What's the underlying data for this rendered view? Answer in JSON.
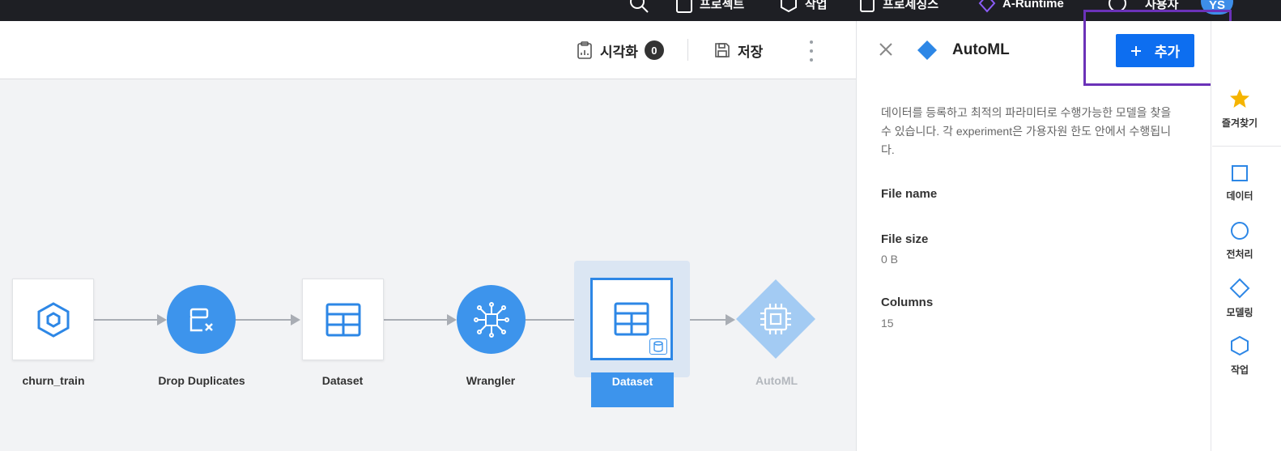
{
  "topbar": {
    "items": [
      {
        "label": "",
        "icon": "search-icon"
      },
      {
        "label": "프로젝트",
        "icon": "clipboard-icon"
      },
      {
        "label": "작업",
        "icon": "hexagon-icon"
      },
      {
        "label": "프로세싱스",
        "icon": "document-icon"
      },
      {
        "label": "A-Runtime",
        "icon": "diamond-icon"
      },
      {
        "label": "사용자",
        "icon": "info-icon"
      }
    ],
    "avatar": "YS"
  },
  "toolbar": {
    "visualize_label": "시각화",
    "visualize_count": "0",
    "save_label": "저장"
  },
  "pipeline": {
    "nodes": [
      {
        "label": "churn_train",
        "shape": "square",
        "icon": "hexagon-icon"
      },
      {
        "label": "Drop Duplicates",
        "shape": "circle",
        "icon": "drop-duplicates-icon"
      },
      {
        "label": "Dataset",
        "shape": "square",
        "icon": "table-icon"
      },
      {
        "label": "Wrangler",
        "shape": "circle",
        "icon": "wrangler-icon"
      },
      {
        "label": "Dataset",
        "shape": "square",
        "icon": "table-icon",
        "selected": true
      },
      {
        "label": "AutoML",
        "shape": "diamond",
        "icon": "chip-icon",
        "faded": true
      }
    ]
  },
  "panel": {
    "title": "AutoML",
    "add_button": "추가",
    "add_button_icon": "plus-icon",
    "description": "데이터를 등록하고 최적의 파라미터로 수행가능한 모델을 찾을 수 있습니다. 각 experiment은 가용자원 한도 안에서 수행됩니다.",
    "fields": [
      {
        "label": "File name",
        "value": ""
      },
      {
        "label": "File size",
        "value": "0 B"
      },
      {
        "label": "Columns",
        "value": "15"
      }
    ]
  },
  "rail": {
    "items": [
      {
        "label": "즐겨찾기",
        "icon": "star-icon"
      },
      {
        "label": "데이터",
        "icon": "square-icon"
      },
      {
        "label": "전처리",
        "icon": "circle-icon"
      },
      {
        "label": "모델링",
        "icon": "diamond-icon"
      },
      {
        "label": "작업",
        "icon": "hexagon-icon"
      }
    ]
  },
  "colors": {
    "accent": "#3d94ec",
    "primary_button": "#0d6ef0",
    "highlight": "#6b32b8",
    "star": "#f5b400"
  }
}
